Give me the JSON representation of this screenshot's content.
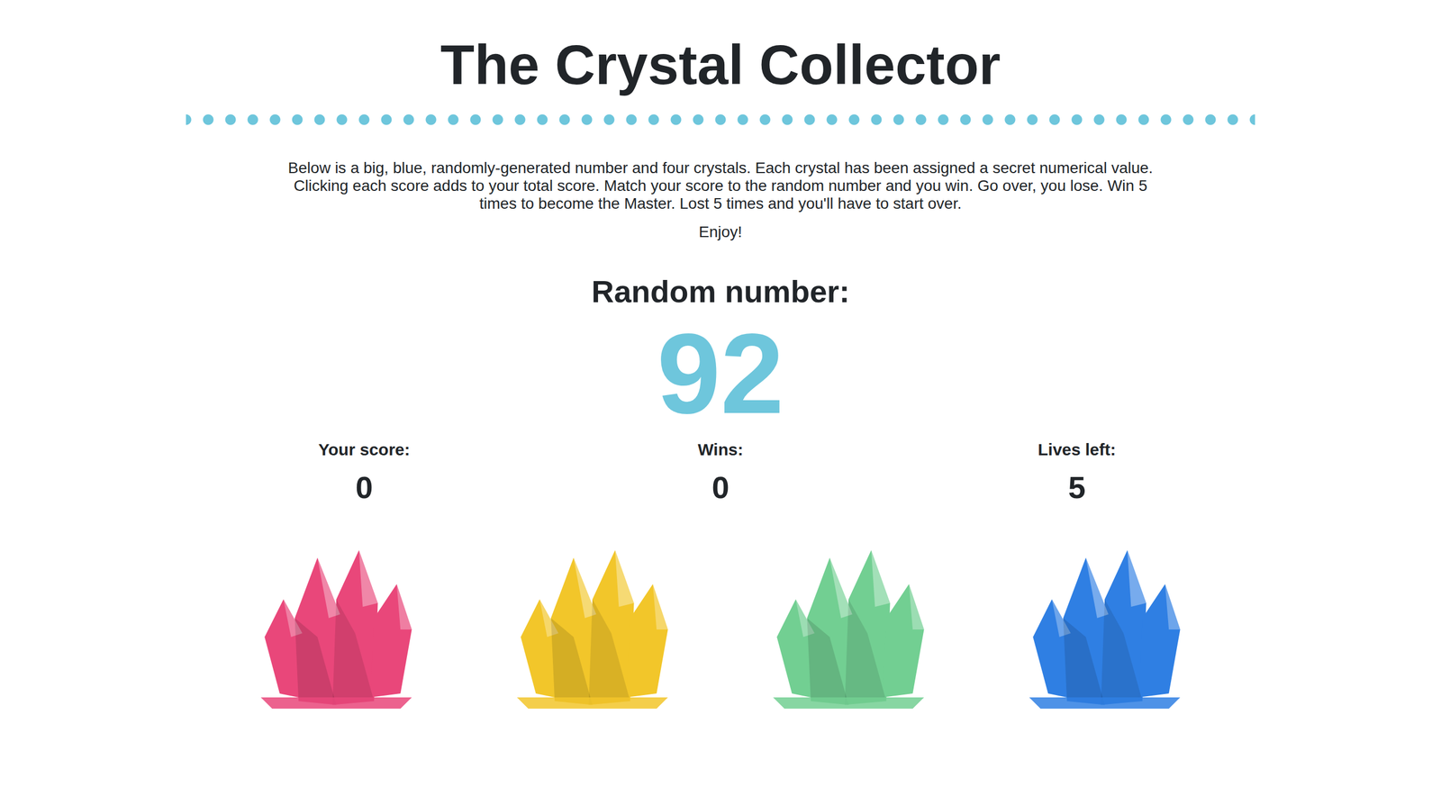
{
  "title": "The Crystal Collector",
  "instructions": "Below is a big, blue, randomly-generated number and four crystals. Each crystal has been assigned a secret numerical value. Clicking each score adds to your total score. Match your score to the random number and you win. Go over, you lose. Win 5 times to become the Master. Lost 5 times and you'll have to start over.",
  "enjoy": "Enjoy!",
  "target": {
    "label": "Random number:",
    "value": "92"
  },
  "stats": [
    {
      "label": "Your score:",
      "value": "0"
    },
    {
      "label": "Wins:",
      "value": "0"
    },
    {
      "label": "Lives left:",
      "value": "5"
    }
  ],
  "crystals": [
    {
      "color": "#e9477a"
    },
    {
      "color": "#f2c62a"
    },
    {
      "color": "#72cf92"
    },
    {
      "color": "#2f7fe3"
    }
  ]
}
